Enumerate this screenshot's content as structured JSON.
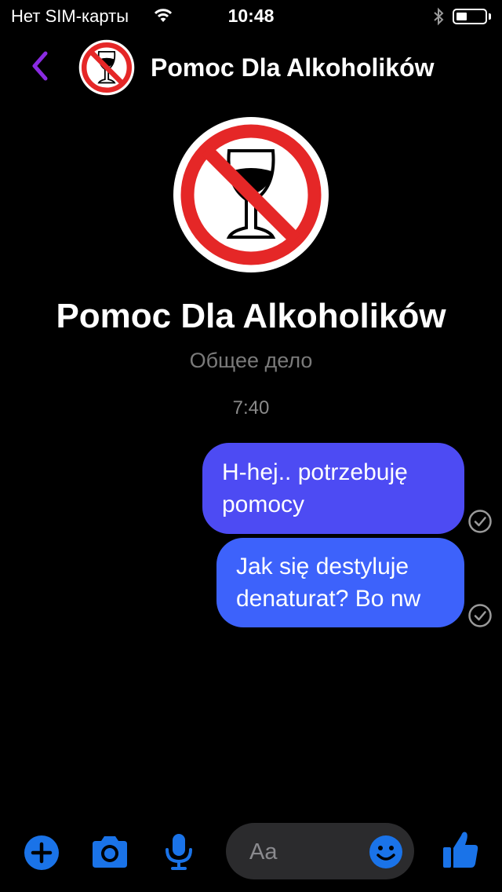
{
  "status_bar": {
    "carrier": "Нет SIM-карты",
    "time": "10:48",
    "icons": [
      "wifi-icon",
      "bluetooth-icon",
      "battery-icon"
    ]
  },
  "header": {
    "back_icon": "chevron-left-icon",
    "title": "Pomoc Dla Alkoholików"
  },
  "profile": {
    "name": "Pomoc Dla Alkoholików",
    "subtitle": "Общее дело"
  },
  "conversation": {
    "timestamp": "7:40",
    "messages": [
      {
        "lines": [
          "H-hej.. potrzebuję",
          "pomocy"
        ],
        "status": "sent-check-icon"
      },
      {
        "lines": [
          "Jak się destyluje",
          "denaturat? Bo nw"
        ],
        "status": "sent-check-icon"
      }
    ]
  },
  "composer": {
    "placeholder": "Aa",
    "icons": [
      "plus-icon",
      "camera-icon",
      "microphone-icon",
      "emoji-icon",
      "thumbs-up-icon"
    ]
  },
  "colors": {
    "accent": "#1a73e8",
    "back": "#8a2be2",
    "bubble_1": "#4d4bf3",
    "bubble_2": "#3d62fb",
    "background": "#000000"
  }
}
